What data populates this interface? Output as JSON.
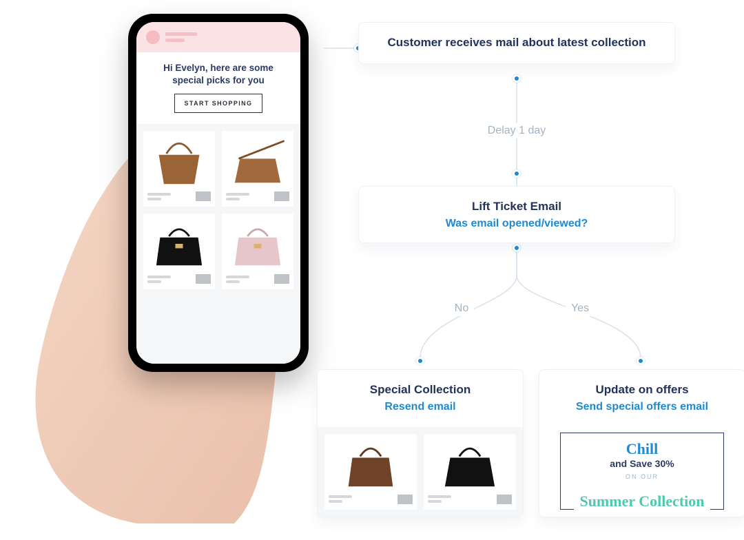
{
  "email_mock": {
    "greeting": "Hi Evelyn, here are some special picks for you",
    "cta": "START SHOPPING"
  },
  "flow": {
    "step1": "Customer receives mail about latest collection",
    "delay_label": "Delay 1 day",
    "step2_title": "Lift Ticket Email",
    "step2_sub": "Was email opened/viewed?",
    "branch_no": "No",
    "branch_yes": "Yes",
    "no_title": "Special Collection",
    "no_sub": "Resend email",
    "yes_title": "Update on offers",
    "yes_sub": "Send special offers email"
  },
  "promo": {
    "headline": "Chill",
    "save": "and Save 30%",
    "on": "ON OUR",
    "collection": "Summer Collection"
  },
  "colors": {
    "navy": "#223259",
    "blue": "#1f8ad3",
    "muted": "#9fb5c7",
    "teal": "#4fc8b0"
  }
}
